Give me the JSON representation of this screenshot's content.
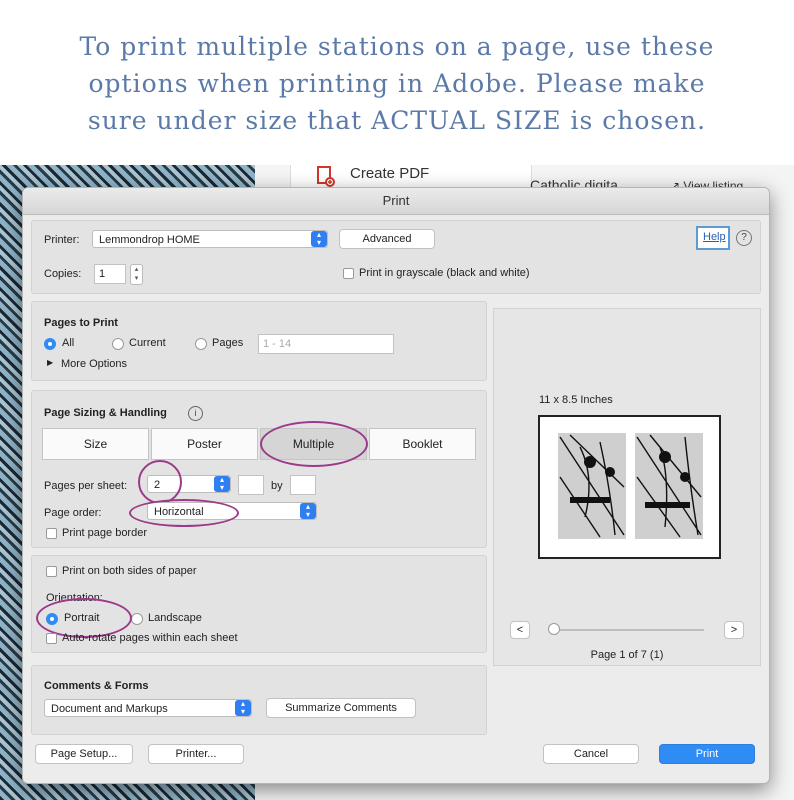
{
  "caption": {
    "line1": "To print multiple stations on a page, use these",
    "line2": "options when printing in Adobe. Please make",
    "line3": "sure under size that ACTUAL SIZE is chosen."
  },
  "background": {
    "create_pdf": "Create PDF",
    "catholic": "Catholic digita",
    "view_listing": "↗ View listing"
  },
  "dialog": {
    "title": "Print",
    "printer_label": "Printer:",
    "printer_value": "Lemmondrop HOME",
    "advanced": "Advanced",
    "help": "Help",
    "help_icon": "?",
    "copies_label": "Copies:",
    "copies_value": "1",
    "grayscale": "Print in grayscale (black and white)",
    "pages_to_print": {
      "heading": "Pages to Print",
      "all": "All",
      "current": "Current",
      "pages": "Pages",
      "pages_placeholder": "1 - 14",
      "more_options": "More Options"
    },
    "sizing": {
      "heading": "Page Sizing & Handling",
      "info_icon": "i",
      "tabs": [
        "Size",
        "Poster",
        "Multiple",
        "Booklet"
      ],
      "pages_per_sheet_label": "Pages per sheet:",
      "pages_per_sheet_value": "2",
      "by": "by",
      "page_order_label": "Page order:",
      "page_order_value": "Horizontal",
      "print_page_border": "Print page border"
    },
    "orientation_panel": {
      "both_sides": "Print on both sides of paper",
      "orientation_label": "Orientation:",
      "portrait": "Portrait",
      "landscape": "Landscape",
      "auto_rotate": "Auto-rotate pages within each sheet"
    },
    "comments": {
      "heading": "Comments & Forms",
      "value": "Document and Markups",
      "summarize": "Summarize Comments"
    },
    "preview": {
      "size": "11 x 8.5 Inches",
      "page_info": "Page 1 of 7 (1)",
      "prev": "<",
      "next": ">"
    },
    "footer": {
      "page_setup": "Page Setup...",
      "printer": "Printer...",
      "cancel": "Cancel",
      "print": "Print"
    }
  },
  "colors": {
    "caption": "#5b7aa8",
    "accent": "#2f8cf5",
    "highlight_circle": "#9b3a8a"
  }
}
